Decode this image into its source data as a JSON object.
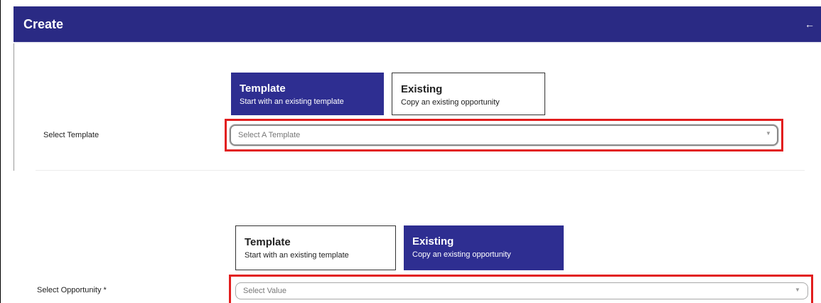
{
  "header": {
    "title": "Create",
    "back_icon": "←"
  },
  "section_template": {
    "cards": {
      "template": {
        "title": "Template",
        "subtitle": "Start with an existing template"
      },
      "existing": {
        "title": "Existing",
        "subtitle": "Copy an existing opportunity"
      }
    },
    "field_label": "Select Template",
    "select_placeholder": "Select A Template",
    "selected_card": "template"
  },
  "section_existing": {
    "cards": {
      "template": {
        "title": "Template",
        "subtitle": "Start with an existing template"
      },
      "existing": {
        "title": "Existing",
        "subtitle": "Copy an existing opportunity"
      }
    },
    "field_label": "Select Opportunity *",
    "select_placeholder": "Select Value",
    "selected_card": "existing"
  },
  "icons": {
    "back": "arrow-left-icon",
    "dropdown": "caret-down-icon"
  },
  "colors": {
    "header_bg": "#2a2a84",
    "active_card_bg": "#2e2e91",
    "highlight": "#e21e1e"
  },
  "glyphs": {
    "caret": "▼"
  }
}
